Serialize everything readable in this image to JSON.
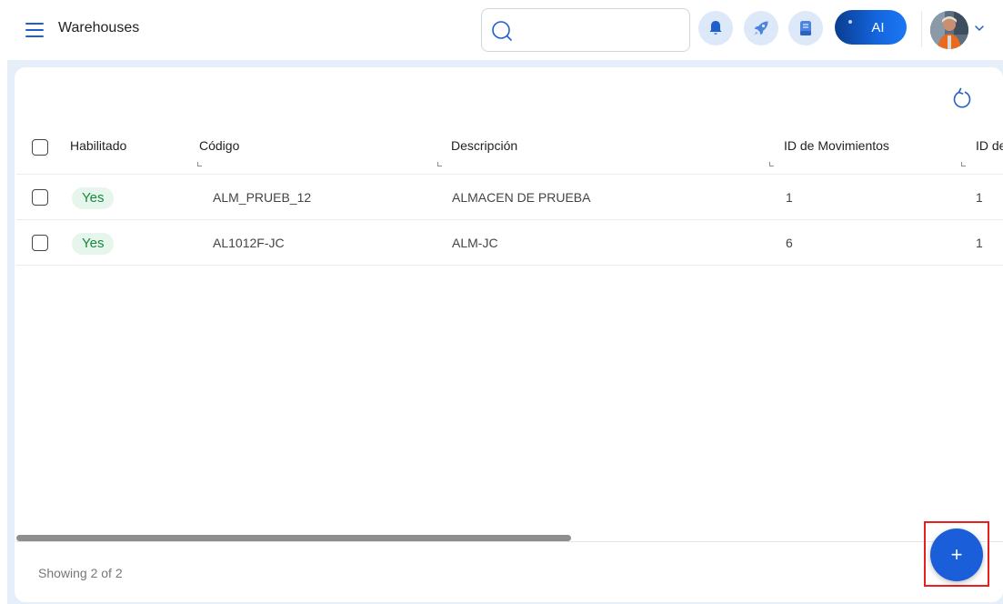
{
  "header": {
    "title": "Warehouses",
    "search": {
      "value": "",
      "placeholder": ""
    },
    "ai_label": "AI"
  },
  "table": {
    "columns": [
      "Habilitado",
      "Código",
      "Descripción",
      "ID de Movimientos",
      "ID de"
    ],
    "rows": [
      {
        "habilitado": "Yes",
        "codigo": "ALM_PRUEB_12",
        "descripcion": "ALMACEN DE PRUEBA",
        "id_movimientos": "1",
        "id_de": "1"
      },
      {
        "habilitado": "Yes",
        "codigo": "AL1012F-JC",
        "descripcion": "ALM-JC",
        "id_movimientos": "6",
        "id_de": "1"
      }
    ]
  },
  "footer": {
    "showing": "Showing 2 of 2"
  },
  "fab": {
    "label": "+"
  },
  "colors": {
    "accent": "#1a5fd9",
    "badge_bg": "#e7f6ec",
    "badge_text": "#17893d",
    "highlight": "#e81f1f",
    "content_bg": "#e6eef9"
  },
  "icons": [
    "menu-icon",
    "search-icon",
    "bell-icon",
    "rocket-icon",
    "document-icon",
    "refresh-icon",
    "chevron-down-icon",
    "plus-icon"
  ]
}
